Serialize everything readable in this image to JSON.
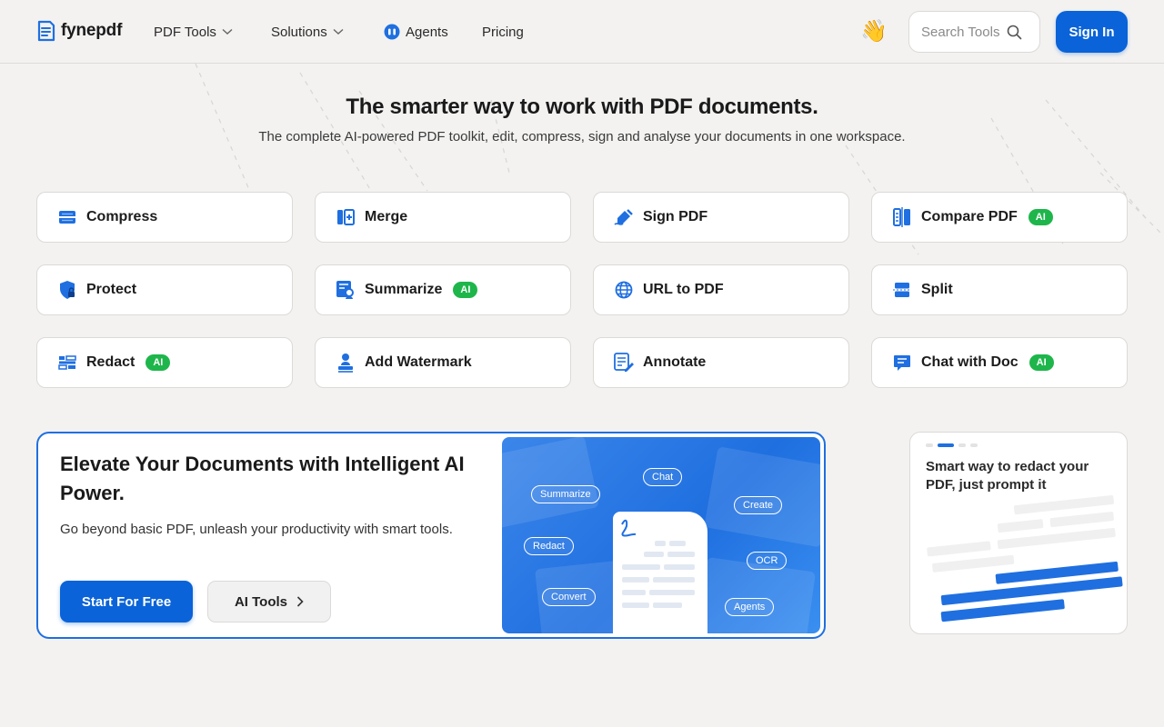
{
  "header": {
    "logo_text": "fynepdf",
    "nav": [
      {
        "label": "PDF Tools"
      },
      {
        "label": "Solutions"
      },
      {
        "label": "Agents"
      },
      {
        "label": "Pricing"
      }
    ],
    "wave_emoji": "👋",
    "search_placeholder": "Search Tools",
    "signin_label": "Sign In"
  },
  "hero": {
    "title": "The smarter way to work with PDF documents.",
    "subtitle": "The complete AI-powered PDF toolkit, edit, compress, sign and analyse your documents in one workspace."
  },
  "tools": [
    {
      "label": "Compress",
      "icon": "compress-icon",
      "ai": false
    },
    {
      "label": "Merge",
      "icon": "merge-icon",
      "ai": false
    },
    {
      "label": "Sign PDF",
      "icon": "sign-icon",
      "ai": false
    },
    {
      "label": "Compare PDF",
      "icon": "compare-icon",
      "ai": true
    },
    {
      "label": "Protect",
      "icon": "shield-lock-icon",
      "ai": false
    },
    {
      "label": "Summarize",
      "icon": "summarize-icon",
      "ai": true
    },
    {
      "label": "URL to PDF",
      "icon": "globe-icon",
      "ai": false
    },
    {
      "label": "Split",
      "icon": "split-icon",
      "ai": false
    },
    {
      "label": "Redact",
      "icon": "redact-icon",
      "ai": true
    },
    {
      "label": "Add Watermark",
      "icon": "watermark-icon",
      "ai": false
    },
    {
      "label": "Annotate",
      "icon": "annotate-icon",
      "ai": false
    },
    {
      "label": "Chat with Doc",
      "icon": "chat-icon",
      "ai": true
    }
  ],
  "ai_badge": "AI",
  "promo": {
    "title": "Elevate Your Documents with Intelligent AI Power.",
    "description": "Go beyond basic PDF, unleash your productivity with smart tools.",
    "primary_button": "Start For Free",
    "secondary_button": "AI Tools",
    "chips": [
      "Chat",
      "Summarize",
      "Create",
      "Redact",
      "OCR",
      "Convert",
      "Agents"
    ]
  },
  "side_card": {
    "text": "Smart way to redact your PDF, just prompt it"
  },
  "colors": {
    "accent": "#0a63d8",
    "ai_badge": "#1eb64b",
    "background": "#f3f2f1"
  }
}
